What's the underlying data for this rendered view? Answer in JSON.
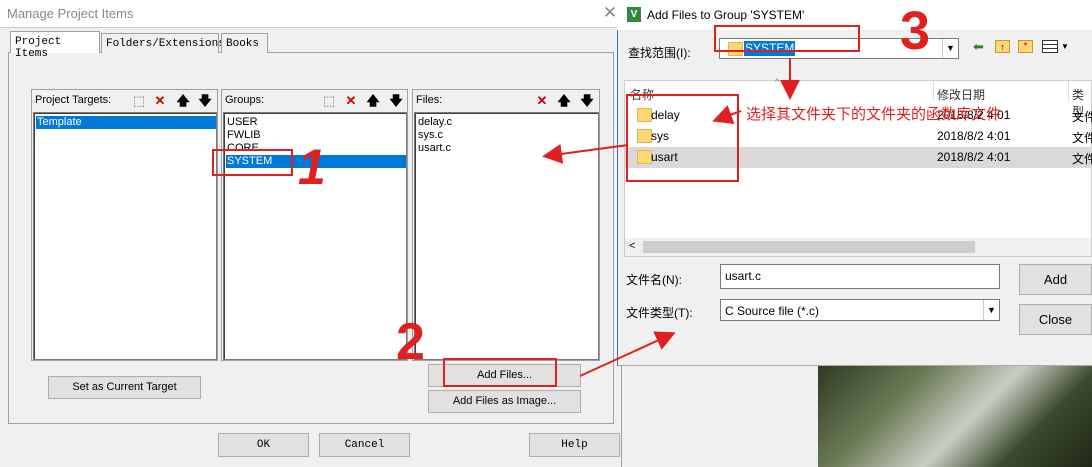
{
  "manage_dialog": {
    "title": "Manage Project Items",
    "close_glyph": "✕",
    "tabs": [
      "Project Items",
      "Folders/Extensions",
      "Books"
    ],
    "project_targets": {
      "header": "Project Targets:",
      "items": [
        "Template"
      ]
    },
    "groups": {
      "header": "Groups:",
      "items": [
        "USER",
        "FWLIB",
        "CORE",
        "SYSTEM"
      ]
    },
    "files": {
      "header": "Files:",
      "items": [
        "delay.c",
        "sys.c",
        "usart.c"
      ]
    },
    "set_target_button": "Set as Current Target",
    "add_files_button": "Add Files...",
    "add_files_image_button": "Add Files as Image...",
    "ok_button": "OK",
    "cancel_button": "Cancel",
    "help_button": "Help"
  },
  "add_files_dialog": {
    "title": "Add Files to Group 'SYSTEM'",
    "lookin_label": "查找范围(I):",
    "lookin_value": "SYSTEM",
    "columns": [
      "名称",
      "修改日期",
      "类型"
    ],
    "rows": [
      {
        "name": "delay",
        "date": "2018/8/2 4:01",
        "type": "文件"
      },
      {
        "name": "sys",
        "date": "2018/8/2 4:01",
        "type": "文件"
      },
      {
        "name": "usart",
        "date": "2018/8/2 4:01",
        "type": "文件"
      }
    ],
    "filename_label": "文件名(N):",
    "filename_value": "usart.c",
    "filetype_label": "文件类型(T):",
    "filetype_value": "C Source file (*.c)",
    "add_button": "Add",
    "close_button": "Close"
  },
  "annotations": {
    "note": "选择其文件夹下的文件夹的函数库文件",
    "num1": "1",
    "num2": "2",
    "num3": "3"
  }
}
